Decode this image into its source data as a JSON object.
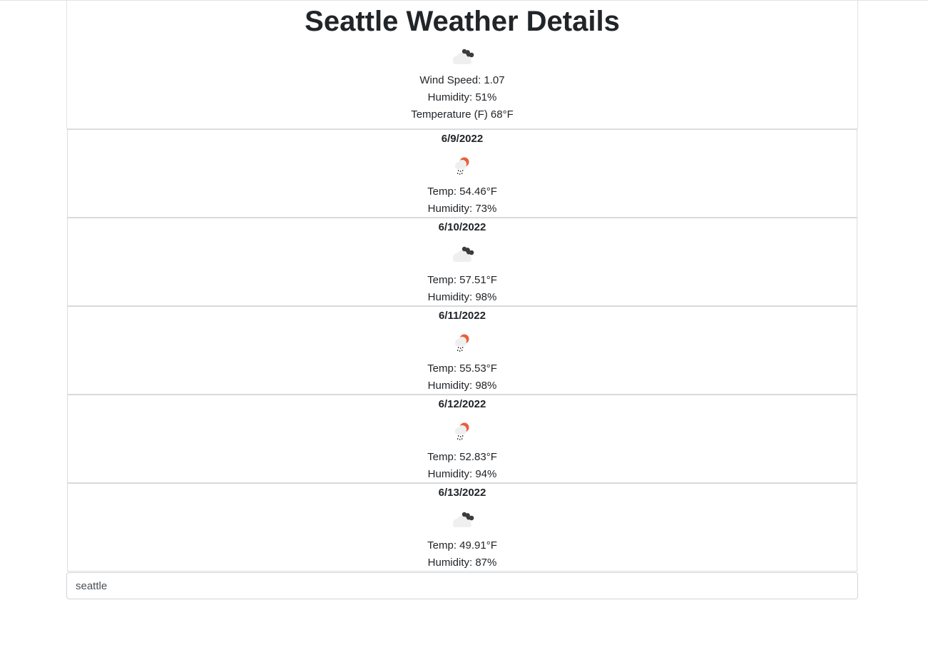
{
  "current": {
    "title": "Seattle Weather Details",
    "icon": "clouds-icon",
    "wind_speed": "Wind Speed: 1.07",
    "humidity": "Humidity: 51%",
    "temperature": "Temperature (F) 68°F"
  },
  "forecast": [
    {
      "date": "6/9/2022",
      "icon": "rain-sun-icon",
      "temp": "Temp: 54.46°F",
      "humidity": "Humidity: 73%"
    },
    {
      "date": "6/10/2022",
      "icon": "clouds-icon",
      "temp": "Temp: 57.51°F",
      "humidity": "Humidity: 98%"
    },
    {
      "date": "6/11/2022",
      "icon": "rain-sun-icon",
      "temp": "Temp: 55.53°F",
      "humidity": "Humidity: 98%"
    },
    {
      "date": "6/12/2022",
      "icon": "rain-sun-icon",
      "temp": "Temp: 52.83°F",
      "humidity": "Humidity: 94%"
    },
    {
      "date": "6/13/2022",
      "icon": "clouds-icon",
      "temp": "Temp: 49.91°F",
      "humidity": "Humidity: 87%"
    }
  ],
  "search": {
    "value": "seattle"
  },
  "colors": {
    "sun": "#e8603c",
    "dark_cloud": "#3c3c3c",
    "light_cloud": "#efefef"
  }
}
